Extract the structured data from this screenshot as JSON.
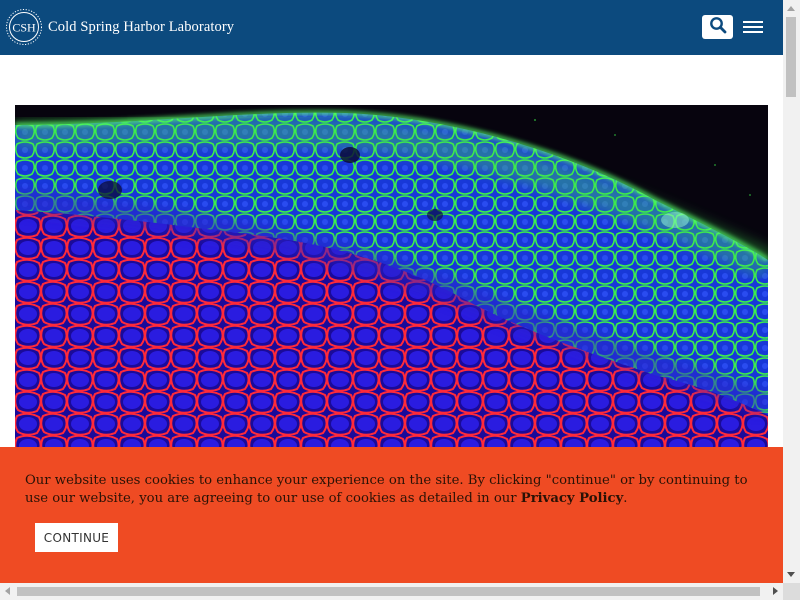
{
  "header": {
    "logo_seal_text": "CSH",
    "logo_name": "Cold Spring Harbor Laboratory",
    "search_icon": "search-icon",
    "menu_icon": "hamburger-menu-icon",
    "background_color": "#0c4a7e"
  },
  "hero": {
    "image_subject": "fluorescence microscopy of tissue: red, blue and green stained cells"
  },
  "cookie_banner": {
    "text_before_link": "Our website uses cookies to enhance your experience on the site. By clicking \"continue\" or by continuing to use our website, you are agreeing to our use of cookies as detailed in our ",
    "link_label": "Privacy Policy",
    "text_after_link": ".",
    "continue_label": "CONTINUE",
    "background_color": "#ef4b23"
  }
}
